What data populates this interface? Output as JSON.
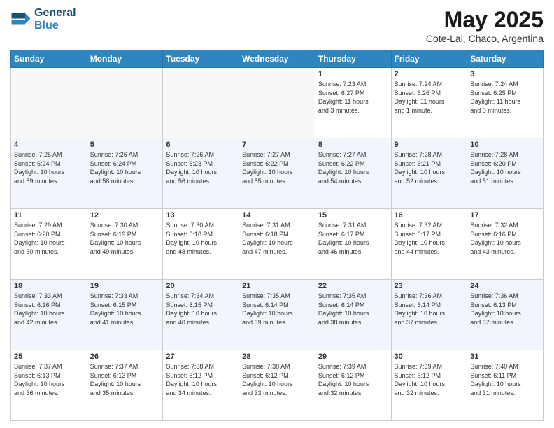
{
  "header": {
    "logo_line1": "General",
    "logo_line2": "Blue",
    "month": "May 2025",
    "location": "Cote-Lai, Chaco, Argentina"
  },
  "days_of_week": [
    "Sunday",
    "Monday",
    "Tuesday",
    "Wednesday",
    "Thursday",
    "Friday",
    "Saturday"
  ],
  "weeks": [
    [
      {
        "day": "",
        "info": ""
      },
      {
        "day": "",
        "info": ""
      },
      {
        "day": "",
        "info": ""
      },
      {
        "day": "",
        "info": ""
      },
      {
        "day": "1",
        "info": "Sunrise: 7:23 AM\nSunset: 6:27 PM\nDaylight: 11 hours\nand 3 minutes."
      },
      {
        "day": "2",
        "info": "Sunrise: 7:24 AM\nSunset: 6:26 PM\nDaylight: 11 hours\nand 1 minute."
      },
      {
        "day": "3",
        "info": "Sunrise: 7:24 AM\nSunset: 6:25 PM\nDaylight: 11 hours\nand 0 minutes."
      }
    ],
    [
      {
        "day": "4",
        "info": "Sunrise: 7:25 AM\nSunset: 6:24 PM\nDaylight: 10 hours\nand 59 minutes."
      },
      {
        "day": "5",
        "info": "Sunrise: 7:26 AM\nSunset: 6:24 PM\nDaylight: 10 hours\nand 58 minutes."
      },
      {
        "day": "6",
        "info": "Sunrise: 7:26 AM\nSunset: 6:23 PM\nDaylight: 10 hours\nand 56 minutes."
      },
      {
        "day": "7",
        "info": "Sunrise: 7:27 AM\nSunset: 6:22 PM\nDaylight: 10 hours\nand 55 minutes."
      },
      {
        "day": "8",
        "info": "Sunrise: 7:27 AM\nSunset: 6:22 PM\nDaylight: 10 hours\nand 54 minutes."
      },
      {
        "day": "9",
        "info": "Sunrise: 7:28 AM\nSunset: 6:21 PM\nDaylight: 10 hours\nand 52 minutes."
      },
      {
        "day": "10",
        "info": "Sunrise: 7:28 AM\nSunset: 6:20 PM\nDaylight: 10 hours\nand 51 minutes."
      }
    ],
    [
      {
        "day": "11",
        "info": "Sunrise: 7:29 AM\nSunset: 6:20 PM\nDaylight: 10 hours\nand 50 minutes."
      },
      {
        "day": "12",
        "info": "Sunrise: 7:30 AM\nSunset: 6:19 PM\nDaylight: 10 hours\nand 49 minutes."
      },
      {
        "day": "13",
        "info": "Sunrise: 7:30 AM\nSunset: 6:18 PM\nDaylight: 10 hours\nand 48 minutes."
      },
      {
        "day": "14",
        "info": "Sunrise: 7:31 AM\nSunset: 6:18 PM\nDaylight: 10 hours\nand 47 minutes."
      },
      {
        "day": "15",
        "info": "Sunrise: 7:31 AM\nSunset: 6:17 PM\nDaylight: 10 hours\nand 46 minutes."
      },
      {
        "day": "16",
        "info": "Sunrise: 7:32 AM\nSunset: 6:17 PM\nDaylight: 10 hours\nand 44 minutes."
      },
      {
        "day": "17",
        "info": "Sunrise: 7:32 AM\nSunset: 6:16 PM\nDaylight: 10 hours\nand 43 minutes."
      }
    ],
    [
      {
        "day": "18",
        "info": "Sunrise: 7:33 AM\nSunset: 6:16 PM\nDaylight: 10 hours\nand 42 minutes."
      },
      {
        "day": "19",
        "info": "Sunrise: 7:33 AM\nSunset: 6:15 PM\nDaylight: 10 hours\nand 41 minutes."
      },
      {
        "day": "20",
        "info": "Sunrise: 7:34 AM\nSunset: 6:15 PM\nDaylight: 10 hours\nand 40 minutes."
      },
      {
        "day": "21",
        "info": "Sunrise: 7:35 AM\nSunset: 6:14 PM\nDaylight: 10 hours\nand 39 minutes."
      },
      {
        "day": "22",
        "info": "Sunrise: 7:35 AM\nSunset: 6:14 PM\nDaylight: 10 hours\nand 38 minutes."
      },
      {
        "day": "23",
        "info": "Sunrise: 7:36 AM\nSunset: 6:14 PM\nDaylight: 10 hours\nand 37 minutes."
      },
      {
        "day": "24",
        "info": "Sunrise: 7:36 AM\nSunset: 6:13 PM\nDaylight: 10 hours\nand 37 minutes."
      }
    ],
    [
      {
        "day": "25",
        "info": "Sunrise: 7:37 AM\nSunset: 6:13 PM\nDaylight: 10 hours\nand 36 minutes."
      },
      {
        "day": "26",
        "info": "Sunrise: 7:37 AM\nSunset: 6:13 PM\nDaylight: 10 hours\nand 35 minutes."
      },
      {
        "day": "27",
        "info": "Sunrise: 7:38 AM\nSunset: 6:12 PM\nDaylight: 10 hours\nand 34 minutes."
      },
      {
        "day": "28",
        "info": "Sunrise: 7:38 AM\nSunset: 6:12 PM\nDaylight: 10 hours\nand 33 minutes."
      },
      {
        "day": "29",
        "info": "Sunrise: 7:39 AM\nSunset: 6:12 PM\nDaylight: 10 hours\nand 32 minutes."
      },
      {
        "day": "30",
        "info": "Sunrise: 7:39 AM\nSunset: 6:12 PM\nDaylight: 10 hours\nand 32 minutes."
      },
      {
        "day": "31",
        "info": "Sunrise: 7:40 AM\nSunset: 6:11 PM\nDaylight: 10 hours\nand 31 minutes."
      }
    ]
  ]
}
